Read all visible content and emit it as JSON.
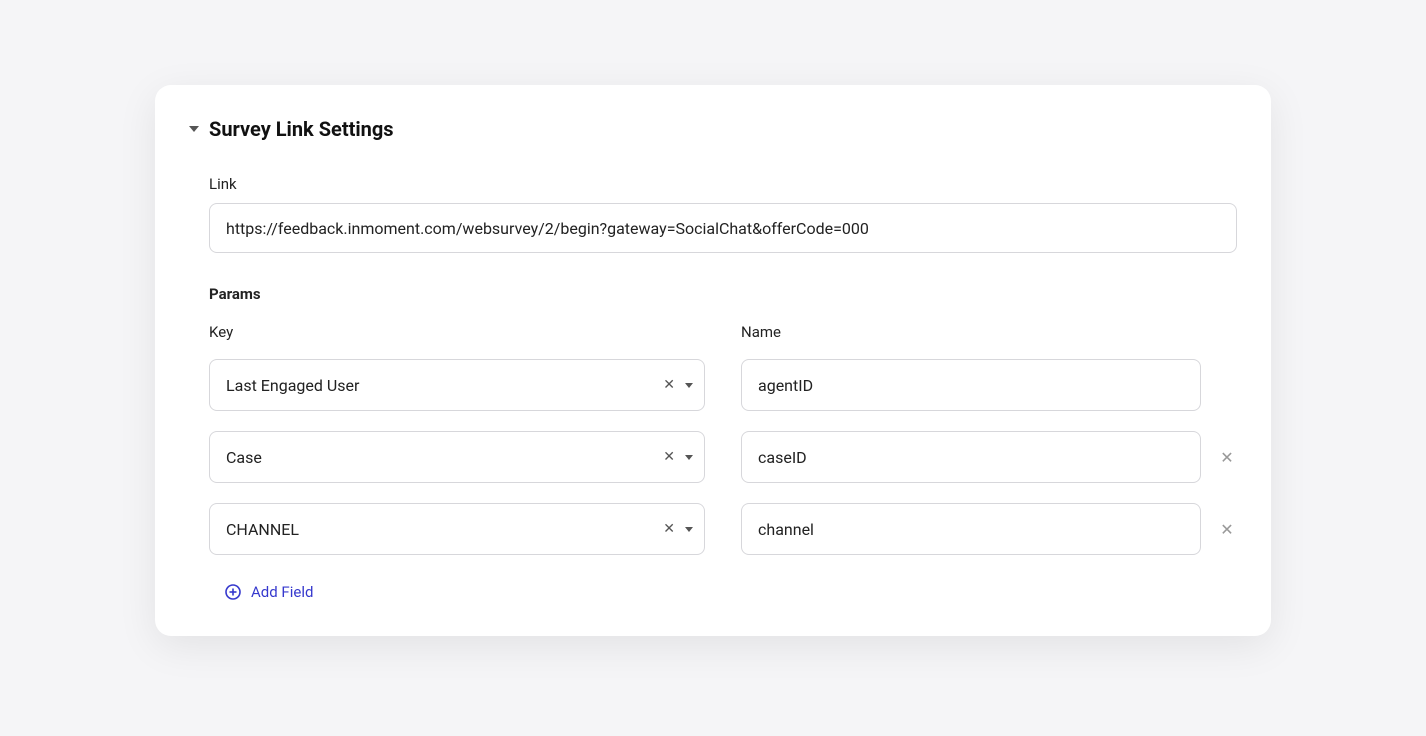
{
  "section": {
    "title": "Survey Link Settings"
  },
  "link": {
    "label": "Link",
    "value": "https://feedback.inmoment.com/websurvey/2/begin?gateway=SocialChat&offerCode=000"
  },
  "params": {
    "heading": "Params",
    "key_label": "Key",
    "name_label": "Name",
    "rows": [
      {
        "key": "Last Engaged User",
        "name": "agentID",
        "removable": false
      },
      {
        "key": "Case",
        "name": "caseID",
        "removable": true
      },
      {
        "key": "CHANNEL",
        "name": "channel",
        "removable": true
      }
    ]
  },
  "add_field": {
    "label": "Add Field"
  }
}
